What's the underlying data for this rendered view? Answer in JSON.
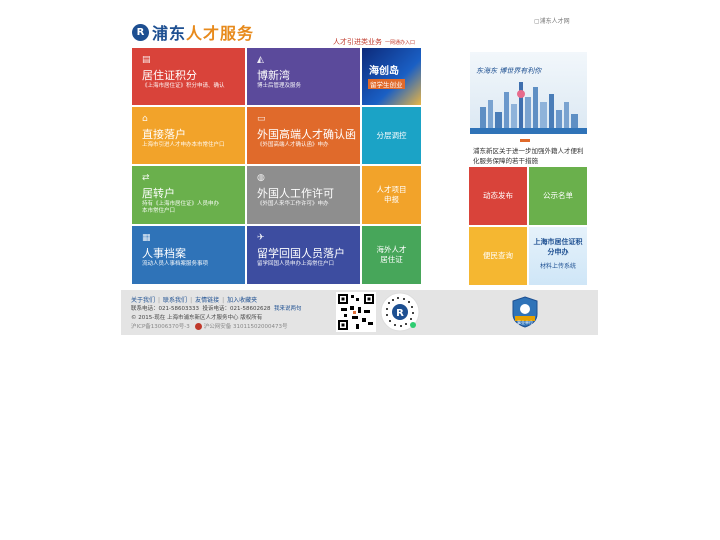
{
  "header": {
    "top_link": "浦东人才网",
    "logo_text_blue": "浦东",
    "logo_text_orange": "人才服务",
    "slogan_main": "人才引进类业务",
    "slogan_sub": "一网通办入口"
  },
  "tiles": [
    {
      "title": "居住证积分",
      "subtitle": "《上海市居住证》积分申请、确认",
      "color": "#d9433a",
      "icon": "id-card-icon"
    },
    {
      "title": "博新湾",
      "subtitle": "博士后管理及服务",
      "color": "#5b4a9b",
      "icon": "graduation-cap-icon"
    },
    {
      "title": "海创岛",
      "subtitle": "留学生创业"
    },
    {
      "title": "直接落户",
      "subtitle": "上海市引进人才申办本市常住户口",
      "color": "#f2a32a",
      "icon": "home-icon"
    },
    {
      "title": "外国高端人才确认函",
      "subtitle": "《外国高端人才确认函》申办",
      "color": "#e06a2b",
      "icon": "card-icon"
    },
    {
      "title": "分层调控",
      "color": "#1ba3c6"
    },
    {
      "title": "居转户",
      "subtitle": "持有《上海市居住证》人员申办",
      "subtitle2": "本市常住户口",
      "color": "#6ab04c",
      "icon": "house-swap-icon"
    },
    {
      "title": "外国人工作许可",
      "subtitle": "《外国人来华工作许可》申办",
      "color": "#8e8e8e",
      "icon": "globe-icon"
    },
    {
      "title": "人才项目",
      "title2": "申报",
      "color": "#f2a32a"
    },
    {
      "title": "人事档案",
      "subtitle": "流动人员人事档案服务事项",
      "color": "#2f73b8",
      "icon": "folder-icon"
    },
    {
      "title": "留学回国人员落户",
      "subtitle": "留学回国人员申办上海常住户口",
      "color": "#3d4da0",
      "icon": "plane-icon"
    },
    {
      "title": "海外人才",
      "title2": "居住证",
      "color": "#47a65a"
    }
  ],
  "right": {
    "banner_text": "东海东 博世界有利你",
    "news_text": "浦东新区关于进一步加强外籍人才便利化服务保障的若干措施",
    "tiles": [
      {
        "label": "动态发布",
        "color": "#d9433a"
      },
      {
        "label": "公示名单",
        "color": "#6ab04c"
      },
      {
        "label": "便民查询",
        "color": "#f5b731"
      },
      {
        "label": "上海市居住证积分申办",
        "label2": "材料上传系统"
      }
    ]
  },
  "footer": {
    "links": [
      "关于我们",
      "联系我们",
      "友情链接",
      "加入收藏夹"
    ],
    "contact_phone_label": "联系电话：",
    "contact_phone": "021-58603333",
    "complaint_label": "投诉电话：",
    "complaint_phone": "021-58602628",
    "feedback": "我来说两句",
    "copyright": "© 2015-现在 上海市浦东新区人才服务中心 版权所有",
    "icp": "沪ICP备13006370号-3",
    "police": "沪公网安备 31011502000473号",
    "badge_text": "事业单位"
  },
  "colors": {
    "brand_blue": "#1d4f91",
    "brand_orange": "#e78a1c"
  }
}
